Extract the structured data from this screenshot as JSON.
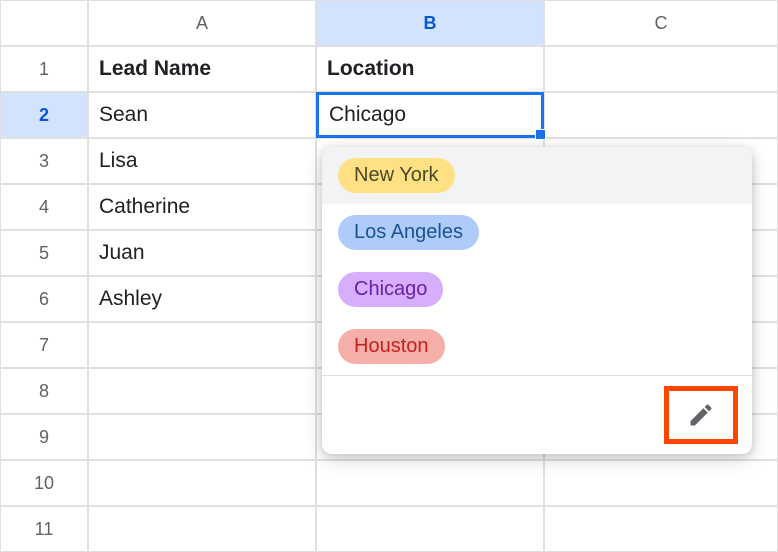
{
  "columns": {
    "A": "A",
    "B": "B",
    "C": "C"
  },
  "rows": {
    "r1": "1",
    "r2": "2",
    "r3": "3",
    "r4": "4",
    "r5": "5",
    "r6": "6",
    "r7": "7",
    "r8": "8",
    "r9": "9",
    "r10": "10",
    "r11": "11"
  },
  "headers": {
    "A": "Lead Name",
    "B": "Location"
  },
  "data": {
    "A2": "Sean",
    "B2": "Chicago",
    "A3": "Lisa",
    "A4": "Catherine",
    "A5": "Juan",
    "A6": "Ashley"
  },
  "active_cell": "B2",
  "dropdown": {
    "options": [
      {
        "label": "New York",
        "color": "yellow"
      },
      {
        "label": "Los Angeles",
        "color": "blue"
      },
      {
        "label": "Chicago",
        "color": "purple"
      },
      {
        "label": "Houston",
        "color": "red"
      }
    ]
  }
}
